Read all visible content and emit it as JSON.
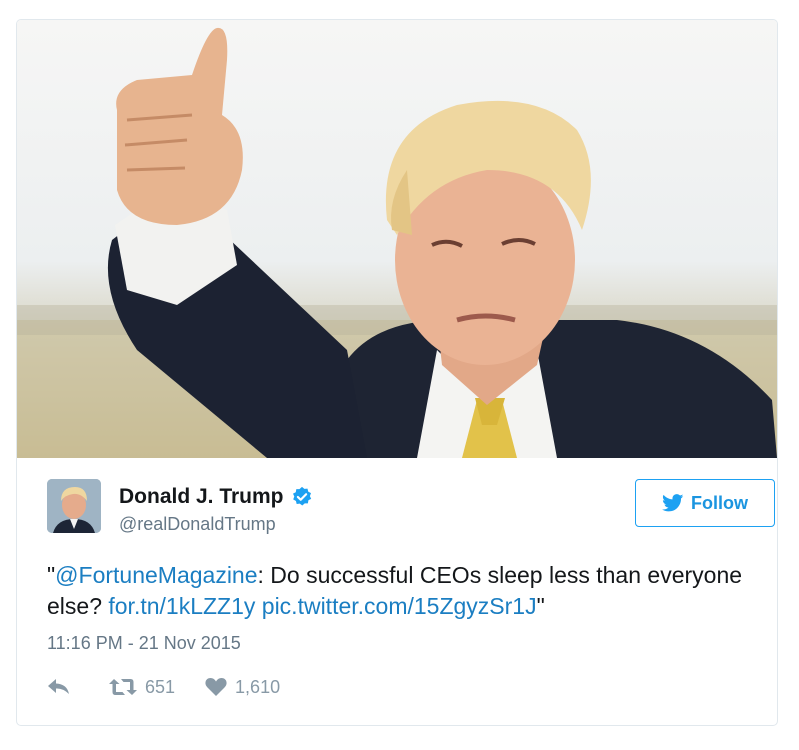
{
  "tweet": {
    "author": {
      "name": "Donald J. Trump",
      "handle": "@realDonaldTrump",
      "verified": true
    },
    "follow_button": {
      "label": "Follow",
      "icon": "bird-icon"
    },
    "text": {
      "open_quote": "\"",
      "mention": "@FortuneMagazine",
      "body": ": Do successful CEOs sleep less than everyone else? ",
      "link_1": "for.tn/1kLZZ1y",
      "space": " ",
      "link_2": "pic.twitter.com/15ZgyzSr1J",
      "close_quote": "\""
    },
    "timestamp": "11:16 PM - 21 Nov 2015",
    "actions": {
      "reply_icon": "reply-icon",
      "retweet_icon": "retweet-icon",
      "retweet_count": "651",
      "like_icon": "heart-icon",
      "like_count": "1,610"
    }
  },
  "colors": {
    "link": "#1b7ec2",
    "accent": "#1da1f2",
    "muted": "#657786",
    "icon_gray": "#8899a6"
  }
}
